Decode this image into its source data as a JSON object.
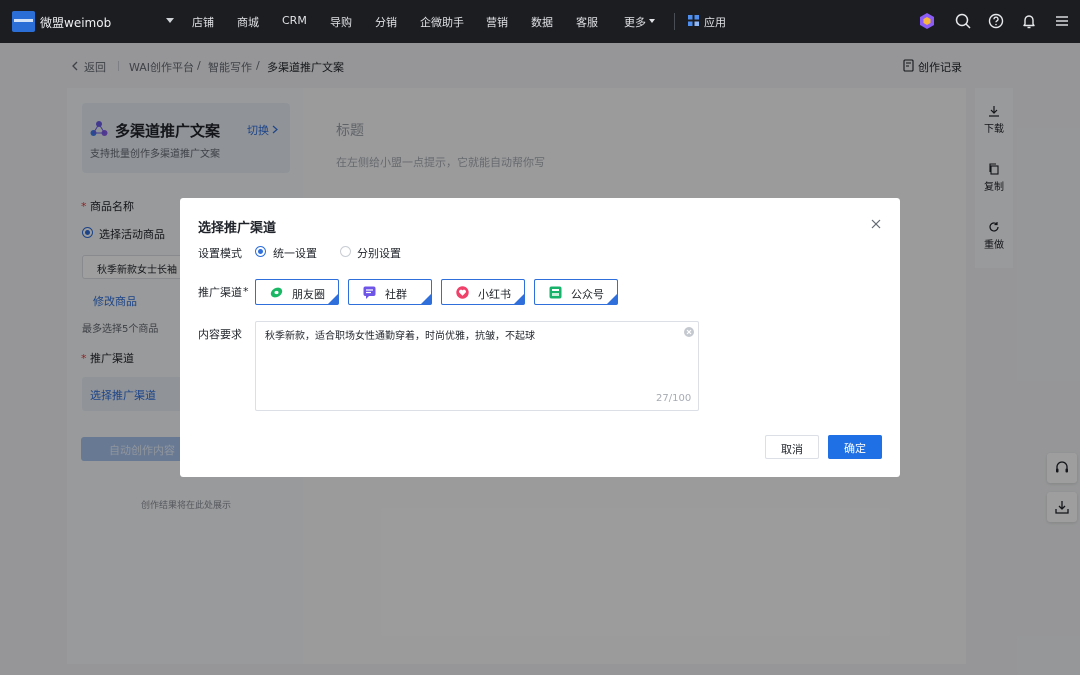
{
  "nav": {
    "brand": "微盟weimob",
    "items": [
      "店铺",
      "商城",
      "CRM",
      "导购",
      "分销",
      "企微助手",
      "营销",
      "数据",
      "客服"
    ],
    "more": "更多",
    "apps": "应用"
  },
  "breadcrumb": {
    "back": "返回",
    "items": [
      "WAI创作平台",
      "智能写作",
      "多渠道推广文案"
    ],
    "sep": "/",
    "record": "创作记录"
  },
  "left": {
    "card_title": "多渠道推广文案",
    "card_sub": "支持批量创作多渠道推广文案",
    "card_switch": "切换",
    "product_label": "商品名称",
    "required_mark": "*",
    "radio_active": "选择活动商品",
    "product_value": "秋季新款女士长袖",
    "modify": "修改商品",
    "limit_hint": "最多选择5个商品",
    "channel_label": "推广渠道",
    "select_channel": "选择推广渠道",
    "auto_button": "自动创作内容",
    "result_hint": "创作结果将在此处展示"
  },
  "center": {
    "title_placeholder": "标题",
    "body_placeholder": "在左侧给小盟一点提示，它就能自动帮你写"
  },
  "rightbar": {
    "download": "下载",
    "copy": "复制",
    "redo": "重做"
  },
  "modal": {
    "title": "选择推广渠道",
    "mode_label": "设置模式",
    "mode_options": [
      "统一设置",
      "分别设置"
    ],
    "channel_label": "推广渠道",
    "required_mark": "*",
    "channels": [
      "朋友圈",
      "社群",
      "小红书",
      "公众号"
    ],
    "content_label": "内容要求",
    "content_value": "秋季新款，适合职场女性通勤穿着，时尚优雅，抗皱，不起球",
    "count": "27/100",
    "cancel": "取消",
    "confirm": "确定"
  },
  "colors": {
    "accent": "#2e6fdb",
    "primary_button": "#1f6fe5",
    "nav_bg": "#1b1d21",
    "required": "#e0393e"
  }
}
